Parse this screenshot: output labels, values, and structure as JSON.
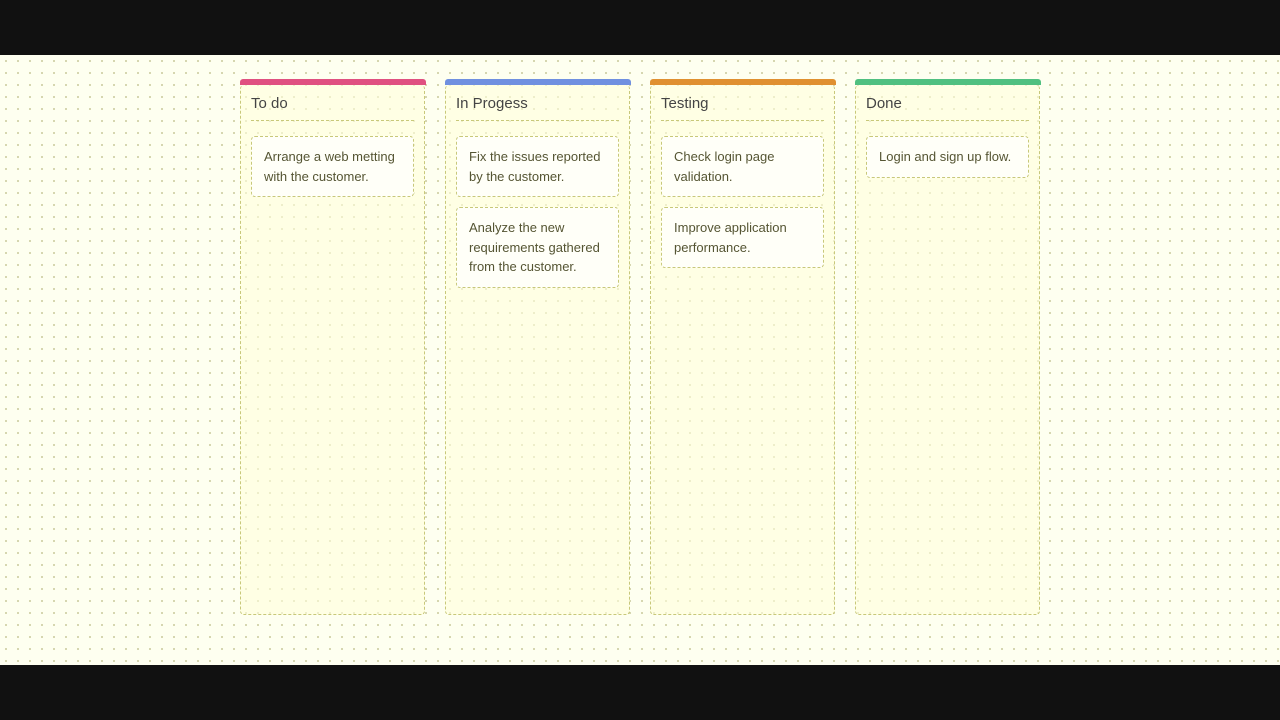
{
  "board": {
    "columns": [
      {
        "id": "todo",
        "title": "To do",
        "cards": [
          {
            "text": "Arrange a web metting with the customer."
          }
        ]
      },
      {
        "id": "inprogress",
        "title": "In Progess",
        "cards": [
          {
            "text": "Fix the issues reported by the customer."
          },
          {
            "text": "Analyze the new requirements gathered from the customer."
          }
        ]
      },
      {
        "id": "testing",
        "title": "Testing",
        "cards": [
          {
            "text": "Check login page validation."
          },
          {
            "text": "Improve application performance."
          }
        ]
      },
      {
        "id": "done",
        "title": "Done",
        "cards": [
          {
            "text": "Login and sign up flow."
          }
        ]
      }
    ]
  }
}
